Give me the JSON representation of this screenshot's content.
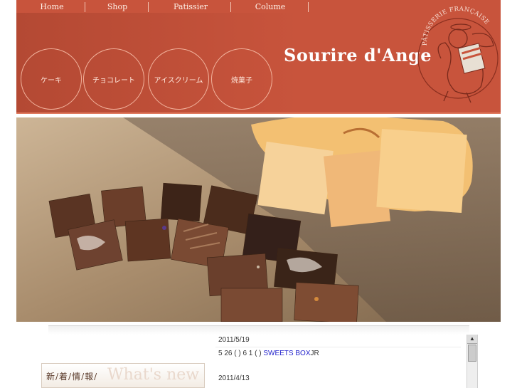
{
  "nav": {
    "items": [
      {
        "label": "Home"
      },
      {
        "label": "Shop"
      },
      {
        "label": "Patissier"
      },
      {
        "label": "Colume"
      }
    ]
  },
  "categories": [
    {
      "label": "ケーキ"
    },
    {
      "label": "チョコレート"
    },
    {
      "label": "アイスクリーム"
    },
    {
      "label": "焼菓子"
    }
  ],
  "brand": {
    "name": "Sourire d'Ange",
    "seal_text": "PÂTISSERIE FRANÇAISE"
  },
  "news": {
    "heading_jp": "新/着/情/報/",
    "heading_en": "What's new",
    "entries": [
      {
        "date": "2011/5/19",
        "text_before": "5 26 ( ) 6 1 ( )  ",
        "link": "SWEETS BOX",
        "text_after": "JR"
      },
      {
        "date": "2011/4/13"
      }
    ]
  },
  "scrollbar": {
    "up_arrow": "▲"
  },
  "colors": {
    "banner": "#c8543c",
    "link": "#2222cc"
  }
}
